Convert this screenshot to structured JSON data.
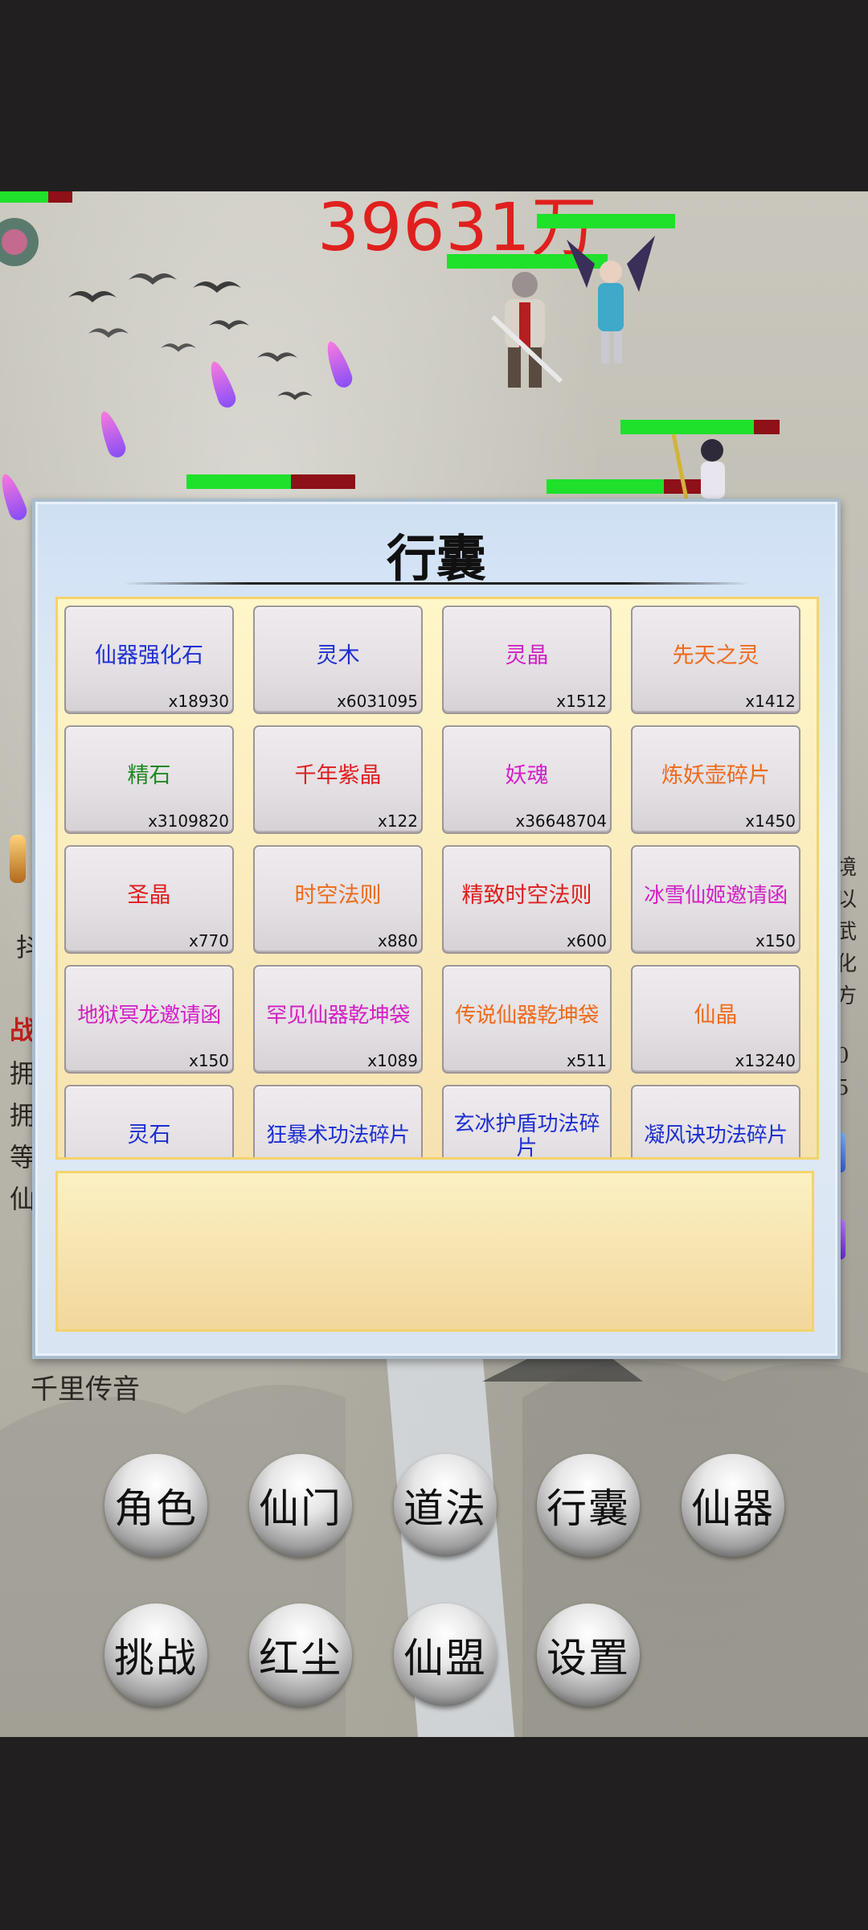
{
  "battle": {
    "damage_text": "39631万"
  },
  "background_labels": {
    "left_1": "抖",
    "left_2": "战",
    "left_3": "拥",
    "left_4": "拥",
    "left_5": "等",
    "left_6": "仙",
    "right_1": "境",
    "right_2": "以",
    "right_3": "武",
    "right_4": "化",
    "right_5": "方",
    "right_6": "0",
    "right_7": "5"
  },
  "inventory": {
    "title": "行囊",
    "items": [
      {
        "name": "仙器强化石",
        "count": "x18930",
        "color": "#1d2fd0"
      },
      {
        "name": "灵木",
        "count": "x6031095",
        "color": "#1d2fd0"
      },
      {
        "name": "灵晶",
        "count": "x1512",
        "color": "#d31fc4"
      },
      {
        "name": "先天之灵",
        "count": "x1412",
        "color": "#ee6a1a"
      },
      {
        "name": "精石",
        "count": "x3109820",
        "color": "#1e8a22"
      },
      {
        "name": "千年紫晶",
        "count": "x122",
        "color": "#e01e1e"
      },
      {
        "name": "妖魂",
        "count": "x36648704",
        "color": "#d31fc4"
      },
      {
        "name": "炼妖壶碎片",
        "count": "x1450",
        "color": "#ee6a1a"
      },
      {
        "name": "圣晶",
        "count": "x770",
        "color": "#e01e1e"
      },
      {
        "name": "时空法则",
        "count": "x880",
        "color": "#ee6a1a"
      },
      {
        "name": "精致时空法则",
        "count": "x600",
        "color": "#e01e1e"
      },
      {
        "name": "冰雪仙姬邀请函",
        "count": "x150",
        "color": "#d31fc4"
      },
      {
        "name": "地狱冥龙邀请函",
        "count": "x150",
        "color": "#d31fc4"
      },
      {
        "name": "罕见仙器乾坤袋",
        "count": "x1089",
        "color": "#d31fc4"
      },
      {
        "name": "传说仙器乾坤袋",
        "count": "x511",
        "color": "#ee6a1a"
      },
      {
        "name": "仙晶",
        "count": "x13240",
        "color": "#ee6a1a"
      },
      {
        "name": "灵石",
        "count": "",
        "color": "#1d2fd0"
      },
      {
        "name": "狂暴术功法碎片",
        "count": "",
        "color": "#1d2fd0"
      },
      {
        "name": "玄冰护盾功法碎片",
        "count": "",
        "color": "#1d2fd0"
      },
      {
        "name": "凝风诀功法碎片",
        "count": "",
        "color": "#1d2fd0"
      }
    ]
  },
  "chat_label": "千里传音",
  "menu": {
    "role": "角色",
    "sect": "仙门",
    "dao": "道法",
    "bag": "行囊",
    "artifact": "仙器",
    "challenge": "挑战",
    "mortal": "红尘",
    "alliance": "仙盟",
    "settings": "设置"
  }
}
